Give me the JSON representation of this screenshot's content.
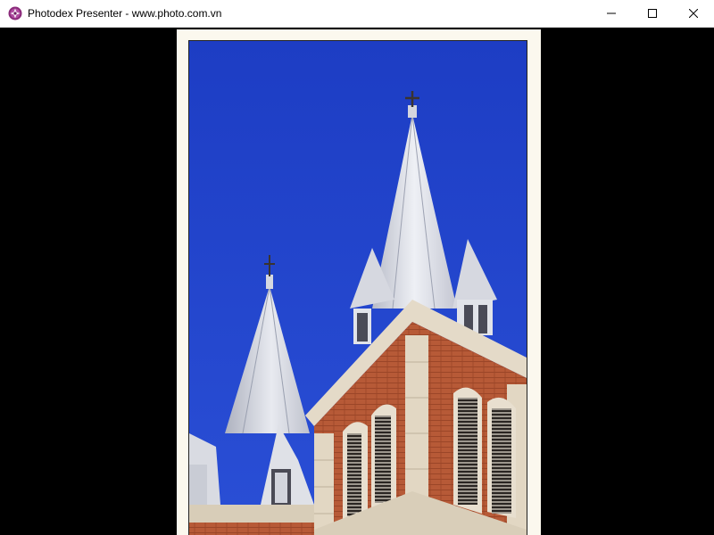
{
  "window": {
    "title": "Photodex Presenter - www.photo.com.vn",
    "icon": "photodex-app-icon",
    "controls": {
      "minimize_icon": "minimize-icon",
      "maximize_icon": "maximize-icon",
      "close_icon": "close-icon"
    }
  },
  "viewer": {
    "background_color": "#000000",
    "frame_color": "#fbf8ee",
    "photo_subject": "cathedral-spires-photo"
  },
  "colors": {
    "sky": "#1f3fc8",
    "brick": "#b65a38",
    "stone": "#e6dccb",
    "spire": "#dcdde3"
  }
}
